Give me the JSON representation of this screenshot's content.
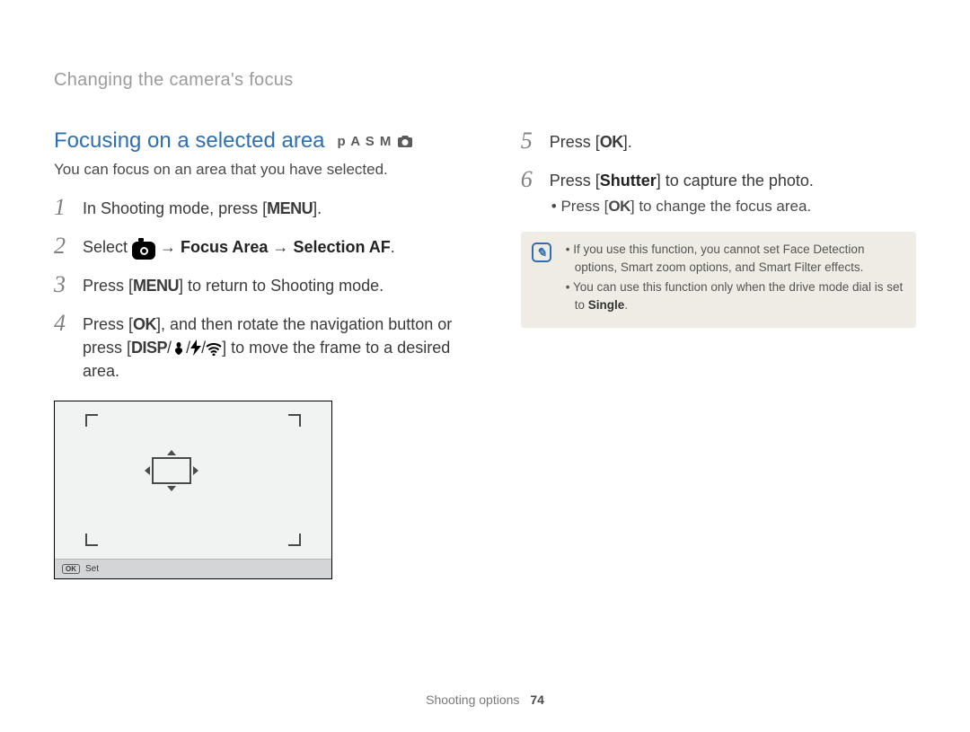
{
  "breadcrumb": "Changing the camera's focus",
  "heading": "Focusing on a selected area",
  "mode_badges": "p A S M",
  "subtitle": "You can focus on an area that you have selected.",
  "step1_a": "In Shooting mode, press [",
  "step1_menu": "MENU",
  "step1_b": "].",
  "step2_a": "Select ",
  "step2_arrow1": " → ",
  "step2_focus_area": "Focus Area",
  "step2_arrow2": " → ",
  "step2_selection_af": "Selection AF",
  "step2_end": ".",
  "step3_a": "Press [",
  "step3_menu": "MENU",
  "step3_b": "] to return to Shooting mode.",
  "step4_a": "Press [",
  "step4_ok": "OK",
  "step4_b": "], and then rotate the navigation button or press [",
  "step4_disp": "DISP",
  "step4_c": "/",
  "step4_d": "/",
  "step4_e": "/",
  "step4_f": "] to move the frame to a desired area.",
  "preview_ok": "OK",
  "preview_set": "Set",
  "step5_a": "Press [",
  "step5_ok": "OK",
  "step5_b": "].",
  "step6_a": "Press [",
  "step6_shutter": "Shutter",
  "step6_b": "] to capture the photo.",
  "step6_sub_a": "Press [",
  "step6_sub_ok": "OK",
  "step6_sub_b": "] to change the focus area.",
  "note1": "If you use this function, you cannot set Face Detection options, Smart zoom options, and Smart Filter effects.",
  "note2_a": "You can use this function only when the drive mode dial is set to ",
  "note2_single": "Single",
  "note2_b": ".",
  "footer_section": "Shooting options",
  "footer_page": "74"
}
